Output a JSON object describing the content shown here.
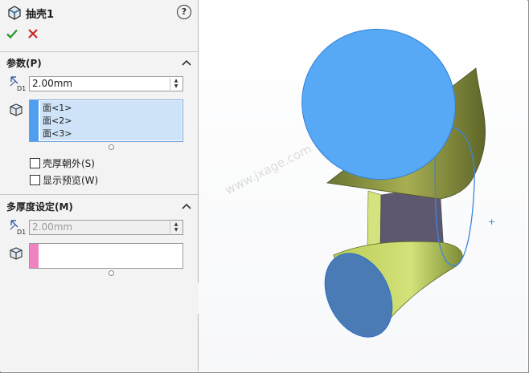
{
  "panel": {
    "title": "抽壳1",
    "help_icon": "?",
    "ok_icon": "check-icon",
    "cancel_icon": "close-icon"
  },
  "parameters": {
    "section_title": "参数(P)",
    "thickness": "2.00mm",
    "faces": [
      "面<1>",
      "面<2>",
      "面<3>"
    ],
    "shell_outward_label": "壳厚朝外(S)",
    "show_preview_label": "显示预览(W)",
    "shell_outward_checked": false,
    "show_preview_checked": false
  },
  "multi_thickness": {
    "section_title": "多厚度设定(M)",
    "thickness": "2.00mm",
    "faces": []
  },
  "viewport": {
    "watermark": "www.jxage.com"
  },
  "colors": {
    "face_selected": "#57a8f5",
    "model_body": "#9ea84a",
    "selection_strip_blue": "#4f9ef0",
    "selection_strip_pink": "#ef82c0",
    "ok_green": "#2e9a2e",
    "cancel_red": "#d22424"
  }
}
